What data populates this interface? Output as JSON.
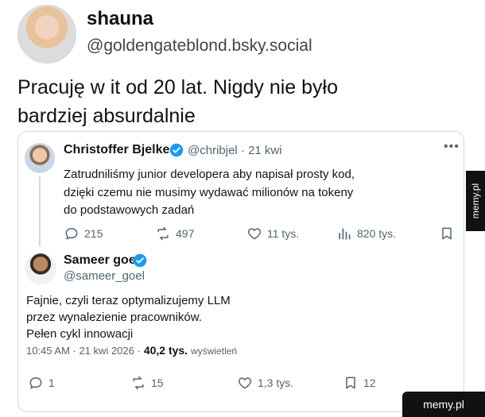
{
  "top_post": {
    "name": "shauna",
    "handle": "@goldengateblond.bsky.social",
    "text": "Pracuję w it od 20 lat. Nigdy nie było\nbardziej absurdalnie"
  },
  "quoted_tweet": {
    "name": "Christoffer Bjelke",
    "handle": "@chribjel · 21 kwi",
    "text": "Zatrudniliśmy junior developera aby napisał prosty kod,\ndzięki czemu nie musimy wydawać milionów na tokeny\ndo podstawowych zadań",
    "actions": {
      "replies": "215",
      "retweets": "497",
      "likes": "11 tys.",
      "views": "820 tys."
    }
  },
  "reply_tweet": {
    "name": "Sameer goel",
    "handle": "@sameer_goel",
    "text": "Fajnie, czyli teraz optymalizujemy LLM\nprzez wynalezienie pracowników.\nPełen cykl innowacji",
    "timestamp": "10:45 AM · 21 kwi 2026 ·",
    "views_count": "40,2 tys.",
    "views_label": "wyświetleń",
    "actions": {
      "replies": "1",
      "retweets": "15",
      "likes": "1,3 tys.",
      "bookmarks": "12"
    }
  },
  "watermarks": {
    "side": "memy.pl",
    "bottom": "memy.pl"
  },
  "colors": {
    "verified": "#1d9bf0",
    "muted": "#536471",
    "border": "#cfd9de"
  }
}
